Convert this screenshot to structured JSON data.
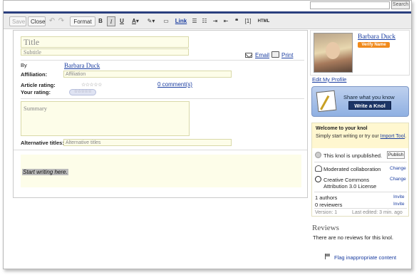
{
  "topbar": {
    "search_button": "Search"
  },
  "toolbar": {
    "save": "Save",
    "close": "Close",
    "undo_icon": "undo-icon",
    "redo_icon": "redo-icon",
    "format": "Format",
    "bold": "B",
    "italic": "I",
    "underline": "U",
    "font_color": "A",
    "highlight_icon": "highlight-icon",
    "image_icon": "image-icon",
    "link": "Link",
    "numbered_list_icon": "numbered-list-icon",
    "bullet_list_icon": "bullet-list-icon",
    "indent_icon": "indent-icon",
    "outdent_icon": "outdent-icon",
    "quote": "❝",
    "reference": "[1]",
    "html": "HTML"
  },
  "editor": {
    "title_placeholder": "Title",
    "subtitle_placeholder": "Subtitle",
    "email_label": "Email",
    "print_label": "Print",
    "by_label": "By",
    "author_name": "Barbara Duck",
    "affiliation_label": "Affiliation:",
    "affiliation_placeholder": "Affiliation",
    "article_rating_label": "Article rating:",
    "article_rating_stars": "☆☆☆☆☆",
    "your_rating_label": "Your rating:",
    "your_rating_stars": "☆☆☆☆☆",
    "comments_link": "0 comment(s)",
    "summary_placeholder": "Summary",
    "alt_titles_label": "Alternative titles:",
    "alt_titles_placeholder": "Alternative titles",
    "start_writing": "Start writing here."
  },
  "profile": {
    "name": "Barbara Duck",
    "verify_badge": "Verify Name",
    "edit_profile": "Edit My Profile"
  },
  "share_box": {
    "prompt": "Share what you know",
    "button": "Write a Knol"
  },
  "welcome": {
    "title": "Welcome to your knol",
    "body_pre": "Simply start writing or try our ",
    "import_link": "Import Tool",
    "body_post": ".",
    "unpublished": "This knol is unpublished.",
    "publish_button": "Publish",
    "moderation": "Moderated collaboration",
    "change1": "Change",
    "license": "Creative Commons Attribution 3.0 License",
    "change2": "Change",
    "authors": "1 authors",
    "invite1": "Invite",
    "reviewers": "0 reviewers",
    "invite2": "Invite",
    "version": "Version: 1",
    "last_edited": "Last edited: 3 min. ago"
  },
  "reviews": {
    "title": "Reviews",
    "empty": "There are no reviews for this knol."
  },
  "flag": {
    "label": "Flag inappropriate content"
  },
  "colors": {
    "brand_bar": "#2a3f7e",
    "link": "#1a3da0",
    "verify_badge": "#f08a1c",
    "field_bg": "#fdfde9",
    "write_button": "#1c3566"
  }
}
